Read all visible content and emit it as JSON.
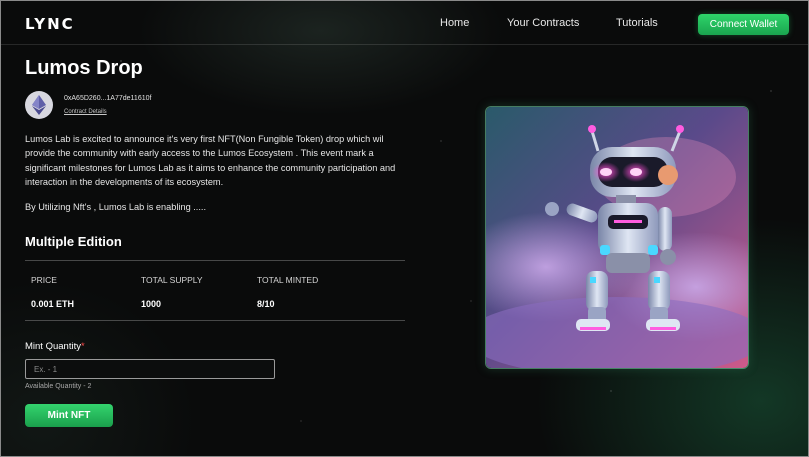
{
  "header": {
    "logo": "LYNC",
    "nav": [
      {
        "label": "Home"
      },
      {
        "label": "Your Contracts"
      },
      {
        "label": "Tutorials"
      }
    ],
    "connect_label": "Connect Wallet"
  },
  "drop": {
    "title": "Lumos Drop",
    "address": "0xA65D260...1A77de11610f",
    "contract_link": "Contract Details",
    "description": "Lumos Lab is excited to announce it's very first NFT(Non Fungible Token) drop which wil provide the community with early access to the Lumos Ecosystem . This event mark a significant milestones for  Lumos Lab as it aims to enhance the community participation and interaction in the developments of its ecosystem.",
    "utilizing": "By Utilizing Nft's , Lumos Lab is enabling ....."
  },
  "edition": {
    "title": "Multiple Edition",
    "stats": [
      {
        "label": "PRICE",
        "value": "0.001 ETH"
      },
      {
        "label": "TOTAL SUPPLY",
        "value": "1000"
      },
      {
        "label": "TOTAL MINTED",
        "value": "8/10"
      }
    ]
  },
  "mint": {
    "label": "Mint Quantity",
    "required_mark": "*",
    "placeholder": "Ex. - 1",
    "available": "Available Quantity - 2",
    "button_label": "Mint NFT"
  },
  "icons": {
    "avatar": "ethereum-icon",
    "nft_image": "robot-nft-image"
  },
  "colors": {
    "accent": "#22b85a",
    "background": "#0a0b0b",
    "required": "#ff4d4d"
  }
}
